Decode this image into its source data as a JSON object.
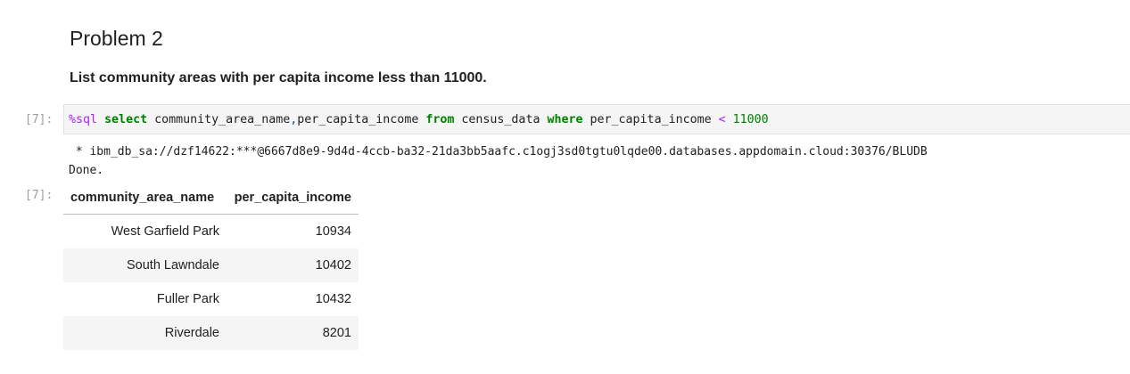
{
  "markdown": {
    "title": "Problem 2",
    "description": "List community areas with per capita income less than 11000."
  },
  "code_cell": {
    "input_prompt": "[7]:",
    "tokens": {
      "magic": "%sql",
      "select": "select",
      "columns_a": "community_area_name",
      "comma": ",",
      "columns_b": "per_capita_income",
      "from": "from",
      "table": "census_data",
      "where": "where",
      "cond_col": "per_capita_income",
      "op": "<",
      "value": "11000"
    }
  },
  "output": {
    "connection_line": " * ibm_db_sa://dzf14622:***@6667d8e9-9d4d-4ccb-ba32-21da3bb5aafc.c1ogj3sd0tgtu0lqde00.databases.appdomain.cloud:30376/BLUDB",
    "done": "Done.",
    "output_prompt": "[7]:",
    "table": {
      "headers": [
        "community_area_name",
        "per_capita_income"
      ],
      "rows": [
        [
          "West Garfield Park",
          "10934"
        ],
        [
          "South Lawndale",
          "10402"
        ],
        [
          "Fuller Park",
          "10432"
        ],
        [
          "Riverdale",
          "8201"
        ]
      ]
    }
  },
  "colors": {
    "keyword": "#008000",
    "magic": "#aa22ff",
    "prompt": "#9e9e9e",
    "cell_background": "#f5f5f5"
  }
}
